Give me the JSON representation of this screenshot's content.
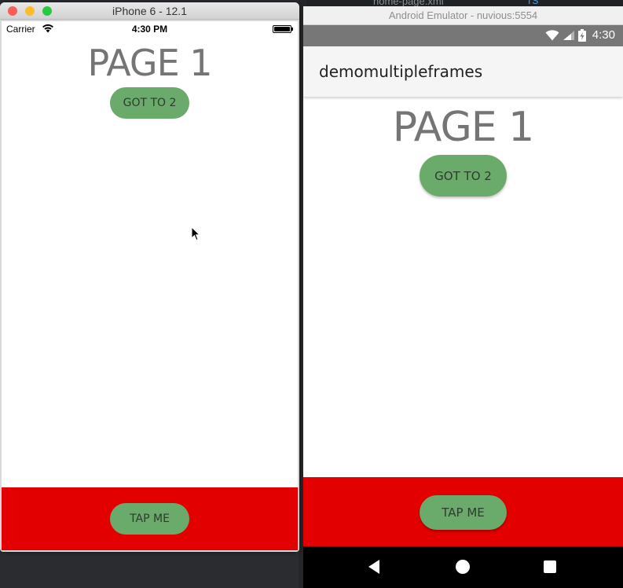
{
  "editor": {
    "file_tab": "home-page.xml",
    "ts_label": "TS"
  },
  "ios": {
    "window_title": "iPhone 6 - 12.1",
    "status": {
      "carrier": "Carrier",
      "time": "4:30 PM"
    },
    "page": {
      "heading": "PAGE 1",
      "goto_label": "GOT TO 2"
    },
    "footer": {
      "tap_label": "TAP ME"
    }
  },
  "android": {
    "window_title": "Android Emulator - nuvious:5554",
    "status": {
      "time": "4:30"
    },
    "toolbar": {
      "title": "demomultipleframes"
    },
    "page": {
      "heading": "PAGE 1",
      "goto_label": "GOT TO 2"
    },
    "footer": {
      "tap_label": "TAP ME"
    }
  },
  "colors": {
    "button_green": "#6aaa6b",
    "footer_red": "#e30000"
  }
}
